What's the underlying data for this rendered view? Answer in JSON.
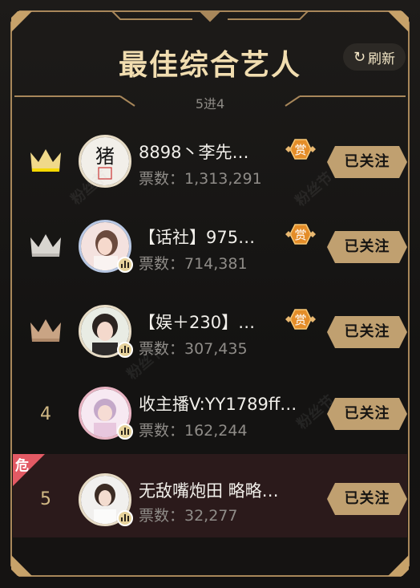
{
  "header": {
    "title": "最佳综合艺人",
    "refresh_label": "刷新",
    "subtitle": "5进4"
  },
  "colors": {
    "gold": "#f0d98a",
    "silver": "#d8d5d0",
    "bronze": "#c9a484",
    "danger": "#e35a64",
    "accent": "#f1ddb0"
  },
  "rows": [
    {
      "rank": "1",
      "rank_icon": "crown-gold-icon",
      "name": "8898丶李先…",
      "votes": "票数：1,313,291",
      "reward": "赏",
      "follow": "已关注",
      "has_reward": true
    },
    {
      "rank": "2",
      "rank_icon": "crown-silver-icon",
      "name": "【话社】975…",
      "votes": "票数：714,381",
      "reward": "赏",
      "follow": "已关注",
      "has_reward": true
    },
    {
      "rank": "3",
      "rank_icon": "crown-bronze-icon",
      "name": "【娱＋230】…",
      "votes": "票数：307,435",
      "reward": "赏",
      "follow": "已关注",
      "has_reward": true
    },
    {
      "rank": "4",
      "name": "收主播V:YY1789ff…",
      "votes": "票数：162,244",
      "follow": "已关注",
      "has_reward": false
    },
    {
      "rank": "5",
      "name": "无敌嘴炮田  略略…",
      "votes": "票数：32,277",
      "follow": "已关注",
      "has_reward": false,
      "tag": "危"
    }
  ],
  "watermark": "粉丝节"
}
